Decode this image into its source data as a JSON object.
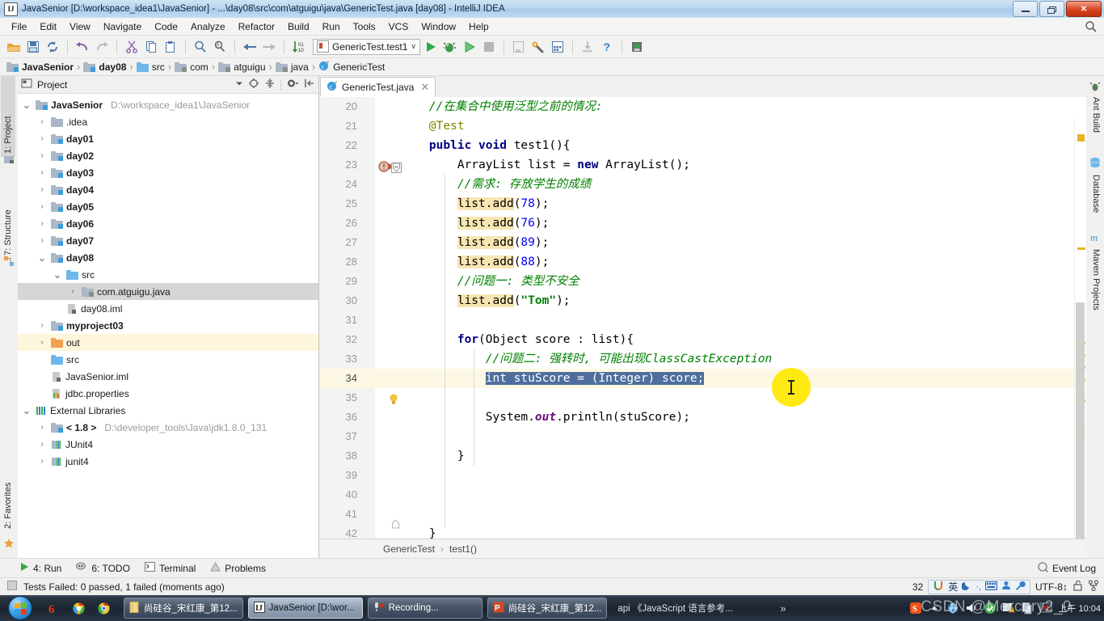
{
  "window": {
    "title": "JavaSenior [D:\\workspace_idea1\\JavaSenior] - ...\\day08\\src\\com\\atguigu\\java\\GenericTest.java [day08] - IntelliJ IDEA",
    "app_icon": "intellij-idea-icon",
    "minimize_label": "–",
    "maximize_label": "❐",
    "close_label": "✕"
  },
  "menu": {
    "items": [
      "File",
      "Edit",
      "View",
      "Navigate",
      "Code",
      "Analyze",
      "Refactor",
      "Build",
      "Run",
      "Tools",
      "VCS",
      "Window",
      "Help"
    ],
    "search_icon": "search-icon"
  },
  "toolbar": {
    "icons": [
      "open-folder-icon",
      "save-all-icon",
      "sync-icon",
      "undo-icon",
      "redo-icon",
      "cut-icon",
      "copy-icon",
      "paste-icon",
      "find-icon",
      "replace-icon",
      "back-icon",
      "forward-icon",
      "sort-icon"
    ],
    "run_config": "GenericTest.test1",
    "run_config_dropdown": "∨",
    "run_icon": "run-icon",
    "debug_icon": "debug-icon",
    "run-coverage_icon": "run-with-coverage-icon",
    "stop_icon": "stop-icon",
    "right_icons": [
      "open-in-window-icon",
      "settings-wrench-icon",
      "project-structure-icon",
      "update-project-icon",
      "help-icon",
      "save-chip-icon"
    ]
  },
  "breadcrumb": {
    "items": [
      {
        "label": "JavaSenior",
        "icon": "module-icon",
        "bold": true
      },
      {
        "label": "day08",
        "icon": "module-icon",
        "bold": true
      },
      {
        "label": "src",
        "icon": "source-folder-icon",
        "bold": false
      },
      {
        "label": "com",
        "icon": "package-icon",
        "bold": false
      },
      {
        "label": "atguigu",
        "icon": "package-icon",
        "bold": false
      },
      {
        "label": "java",
        "icon": "package-icon",
        "bold": false
      },
      {
        "label": "GenericTest",
        "icon": "java-class-icon",
        "bold": false
      }
    ],
    "separator": "›"
  },
  "left_tool_strip": {
    "tabs": [
      {
        "label": "1: Project",
        "selected": true,
        "icon": "project-icon"
      },
      {
        "label": "7: Structure",
        "selected": false,
        "icon": "structure-icon"
      },
      {
        "label": "2: Favorites",
        "selected": false,
        "icon": "star-icon"
      }
    ]
  },
  "right_tool_strip": {
    "tabs": [
      {
        "label": "Ant Build",
        "icon": "ant-icon"
      },
      {
        "label": "Database",
        "icon": "database-icon"
      },
      {
        "label": "Maven Projects",
        "icon": "maven-icon"
      }
    ]
  },
  "project_panel": {
    "title": "Project",
    "dropdown_icon": "chevron-down-icon",
    "header_icons": [
      "locate-icon",
      "collapse-all-icon",
      "settings-gear-icon",
      "hide-icon"
    ],
    "tree": [
      {
        "depth": 0,
        "arrow": "⌄",
        "icon": "module-icon",
        "label": "JavaSenior",
        "bold": true,
        "sub": "D:\\workspace_idea1\\JavaSenior",
        "state": "none"
      },
      {
        "depth": 1,
        "arrow": "›",
        "icon": "folder-icon",
        "label": ".idea",
        "bold": false,
        "sub": "",
        "state": "none"
      },
      {
        "depth": 1,
        "arrow": "›",
        "icon": "module-icon",
        "label": "day01",
        "bold": true,
        "sub": "",
        "state": "none"
      },
      {
        "depth": 1,
        "arrow": "›",
        "icon": "module-icon",
        "label": "day02",
        "bold": true,
        "sub": "",
        "state": "none"
      },
      {
        "depth": 1,
        "arrow": "›",
        "icon": "module-icon",
        "label": "day03",
        "bold": true,
        "sub": "",
        "state": "none"
      },
      {
        "depth": 1,
        "arrow": "›",
        "icon": "module-icon",
        "label": "day04",
        "bold": true,
        "sub": "",
        "state": "none"
      },
      {
        "depth": 1,
        "arrow": "›",
        "icon": "module-icon",
        "label": "day05",
        "bold": true,
        "sub": "",
        "state": "none"
      },
      {
        "depth": 1,
        "arrow": "›",
        "icon": "module-icon",
        "label": "day06",
        "bold": true,
        "sub": "",
        "state": "none"
      },
      {
        "depth": 1,
        "arrow": "›",
        "icon": "module-icon",
        "label": "day07",
        "bold": true,
        "sub": "",
        "state": "none"
      },
      {
        "depth": 1,
        "arrow": "⌄",
        "icon": "module-icon",
        "label": "day08",
        "bold": true,
        "sub": "",
        "state": "none"
      },
      {
        "depth": 2,
        "arrow": "⌄",
        "icon": "source-folder-icon",
        "label": "src",
        "bold": false,
        "sub": "",
        "state": "none"
      },
      {
        "depth": 3,
        "arrow": "›",
        "icon": "package-icon",
        "label": "com.atguigu.java",
        "bold": false,
        "sub": "",
        "state": "selected"
      },
      {
        "depth": 2,
        "arrow": "",
        "icon": "iml-file-icon",
        "label": "day08.iml",
        "bold": false,
        "sub": "",
        "state": "none"
      },
      {
        "depth": 1,
        "arrow": "›",
        "icon": "module-icon",
        "label": "myproject03",
        "bold": true,
        "sub": "",
        "state": "none"
      },
      {
        "depth": 1,
        "arrow": "›",
        "icon": "output-folder-icon",
        "label": "out",
        "bold": false,
        "sub": "",
        "state": "highlighted"
      },
      {
        "depth": 1,
        "arrow": "",
        "icon": "source-folder-icon",
        "label": "src",
        "bold": false,
        "sub": "",
        "state": "none"
      },
      {
        "depth": 1,
        "arrow": "",
        "icon": "iml-file-icon",
        "label": "JavaSenior.iml",
        "bold": false,
        "sub": "",
        "state": "none"
      },
      {
        "depth": 1,
        "arrow": "",
        "icon": "properties-file-icon",
        "label": "jdbc.properties",
        "bold": false,
        "sub": "",
        "state": "none"
      },
      {
        "depth": 0,
        "arrow": "⌄",
        "icon": "external-libraries-icon",
        "label": "External Libraries",
        "bold": false,
        "sub": "",
        "state": "none"
      },
      {
        "depth": 1,
        "arrow": "›",
        "icon": "jdk-icon",
        "label": "< 1.8 >",
        "bold": true,
        "sub": "D:\\developer_tools\\Java\\jdk1.8.0_131",
        "state": "none"
      },
      {
        "depth": 1,
        "arrow": "›",
        "icon": "library-icon",
        "label": "JUnit4",
        "bold": false,
        "sub": "",
        "state": "none"
      },
      {
        "depth": 1,
        "arrow": "›",
        "icon": "library-icon",
        "label": "junit4",
        "bold": false,
        "sub": "",
        "state": "none"
      }
    ]
  },
  "editor": {
    "tab": {
      "label": "GenericTest.java",
      "icon": "java-class-icon",
      "close_icon": "close-icon"
    },
    "first_line_number": 20,
    "current_line": 34,
    "lines": [
      {
        "n": 20,
        "indent": 4,
        "tokens": [
          {
            "t": "//在集合中使用泛型之前的情况:",
            "c": "cmt"
          }
        ]
      },
      {
        "n": 21,
        "indent": 4,
        "tokens": [
          {
            "t": "@Test",
            "c": "ann"
          }
        ]
      },
      {
        "n": 22,
        "indent": 4,
        "gutter_icon": "run-test-failed-icon",
        "fold": true,
        "tokens": [
          {
            "t": "public",
            "c": "kw"
          },
          {
            "t": " ",
            "c": "plain"
          },
          {
            "t": "void",
            "c": "kw"
          },
          {
            "t": " test1(){",
            "c": "plain"
          }
        ]
      },
      {
        "n": 23,
        "indent": 8,
        "tokens": [
          {
            "t": "ArrayList list = ",
            "c": "plain"
          },
          {
            "t": "new",
            "c": "kw"
          },
          {
            "t": " ArrayList();",
            "c": "plain"
          }
        ]
      },
      {
        "n": 24,
        "indent": 8,
        "tokens": [
          {
            "t": "//需求: 存放学生的成绩",
            "c": "cmt"
          }
        ]
      },
      {
        "n": 25,
        "indent": 8,
        "tokens": [
          {
            "t": "list.add",
            "c": "srch"
          },
          {
            "t": "(",
            "c": "plain"
          },
          {
            "t": "78",
            "c": "num-lit"
          },
          {
            "t": ");",
            "c": "plain"
          }
        ]
      },
      {
        "n": 26,
        "indent": 8,
        "tokens": [
          {
            "t": "list.add",
            "c": "srch"
          },
          {
            "t": "(",
            "c": "plain"
          },
          {
            "t": "76",
            "c": "num-lit"
          },
          {
            "t": ");",
            "c": "plain"
          }
        ]
      },
      {
        "n": 27,
        "indent": 8,
        "tokens": [
          {
            "t": "list.add",
            "c": "srch"
          },
          {
            "t": "(",
            "c": "plain"
          },
          {
            "t": "89",
            "c": "num-lit"
          },
          {
            "t": ");",
            "c": "plain"
          }
        ]
      },
      {
        "n": 28,
        "indent": 8,
        "tokens": [
          {
            "t": "list.add",
            "c": "srch"
          },
          {
            "t": "(",
            "c": "plain"
          },
          {
            "t": "88",
            "c": "num-lit"
          },
          {
            "t": ");",
            "c": "plain"
          }
        ]
      },
      {
        "n": 29,
        "indent": 8,
        "tokens": [
          {
            "t": "//问题一: 类型不安全",
            "c": "cmt"
          }
        ]
      },
      {
        "n": 30,
        "indent": 8,
        "tokens": [
          {
            "t": "list.add",
            "c": "srch"
          },
          {
            "t": "(",
            "c": "plain"
          },
          {
            "t": "\"Tom\"",
            "c": "str"
          },
          {
            "t": ");",
            "c": "plain"
          }
        ]
      },
      {
        "n": 31,
        "indent": 0,
        "tokens": []
      },
      {
        "n": 32,
        "indent": 8,
        "tokens": [
          {
            "t": "for",
            "c": "kw"
          },
          {
            "t": "(Object score : list){",
            "c": "plain"
          }
        ]
      },
      {
        "n": 33,
        "indent": 12,
        "tokens": [
          {
            "t": "//问题二: 强转时, 可能出现ClassCastException",
            "c": "cmt"
          }
        ]
      },
      {
        "n": 34,
        "indent": 12,
        "gutter_icon": "intention-bulb-icon",
        "tokens": [
          {
            "t": "int stuScore = (Integer) score;",
            "c": "sel-text"
          }
        ]
      },
      {
        "n": 35,
        "indent": 0,
        "tokens": []
      },
      {
        "n": 36,
        "indent": 12,
        "tokens": [
          {
            "t": "System.",
            "c": "plain"
          },
          {
            "t": "out",
            "c": "fld"
          },
          {
            "t": ".println(stuScore);",
            "c": "plain"
          }
        ]
      },
      {
        "n": 37,
        "indent": 0,
        "tokens": []
      },
      {
        "n": 38,
        "indent": 8,
        "tokens": [
          {
            "t": "}",
            "c": "plain"
          }
        ]
      },
      {
        "n": 39,
        "indent": 0,
        "tokens": []
      },
      {
        "n": 40,
        "indent": 0,
        "tokens": []
      },
      {
        "n": 41,
        "indent": 0,
        "tokens": []
      },
      {
        "n": 42,
        "indent": 4,
        "fold_end": true,
        "tokens": [
          {
            "t": "}",
            "c": "plain"
          }
        ]
      }
    ],
    "breadcrumb": {
      "class": "GenericTest",
      "method": "test1()",
      "separator": "›"
    }
  },
  "bottom_tool_strip": {
    "tabs": [
      {
        "label": "4: Run",
        "underline": "4",
        "icon": "run-icon"
      },
      {
        "label": "6: TODO",
        "underline": "6",
        "icon": "todo-icon"
      },
      {
        "label": "Terminal",
        "underline": "",
        "icon": "terminal-icon"
      },
      {
        "label": "Problems",
        "underline": "",
        "icon": "warning-icon"
      }
    ],
    "event_log": {
      "label": "Event Log",
      "icon": "event-log-icon"
    }
  },
  "status_bar": {
    "message": "Tests Failed: 0 passed, 1 failed (moments ago)",
    "message_icon": "stop-square-icon",
    "memory": "32",
    "encoding": "UTF-8↕",
    "lock_icon": "unlocked-icon",
    "branch_icon": "vcs-branch-icon",
    "ime": {
      "logo": "sogou-ime-icon",
      "mode": "英",
      "moon_icon": "moon-icon",
      "punct_icon": "punctuation-icon",
      "keyboard_icon": "keyboard-icon",
      "user_icon": "user-icon",
      "wrench_icon": "wrench-icon"
    }
  },
  "taskbar": {
    "start_icon": "windows-start-orb",
    "quick_launch": [
      "firefox-icon",
      "chrome-canary-icon",
      "chrome-icon"
    ],
    "tasks": [
      {
        "label": "尚硅谷_宋红康_第12...",
        "icon": "document-icon",
        "active": false
      },
      {
        "label": "JavaSenior [D:\\wor...",
        "icon": "intellij-idea-icon",
        "active": true
      },
      {
        "label": "Recording...",
        "icon": "recorder-icon",
        "active": false
      },
      {
        "label": "尚硅谷_宋红康_第12...",
        "icon": "powerpoint-icon",
        "active": false
      },
      {
        "label": "api 《JavaScript 语言参考...",
        "icon": "chm-help-icon",
        "active": false
      }
    ],
    "overflow": "»",
    "tray": {
      "sogou_icon": "sogou-icon",
      "expand_icon": "show-hidden-icons-icon",
      "network_icon": "network-icon",
      "volume_icon": "volume-icon",
      "shield_icons": [
        "security-shield-icon",
        "alert-icon",
        "copy-icon",
        "media-icon"
      ],
      "clock": "上午 10:04"
    },
    "watermark": "CSDN @Mercury2_0"
  }
}
